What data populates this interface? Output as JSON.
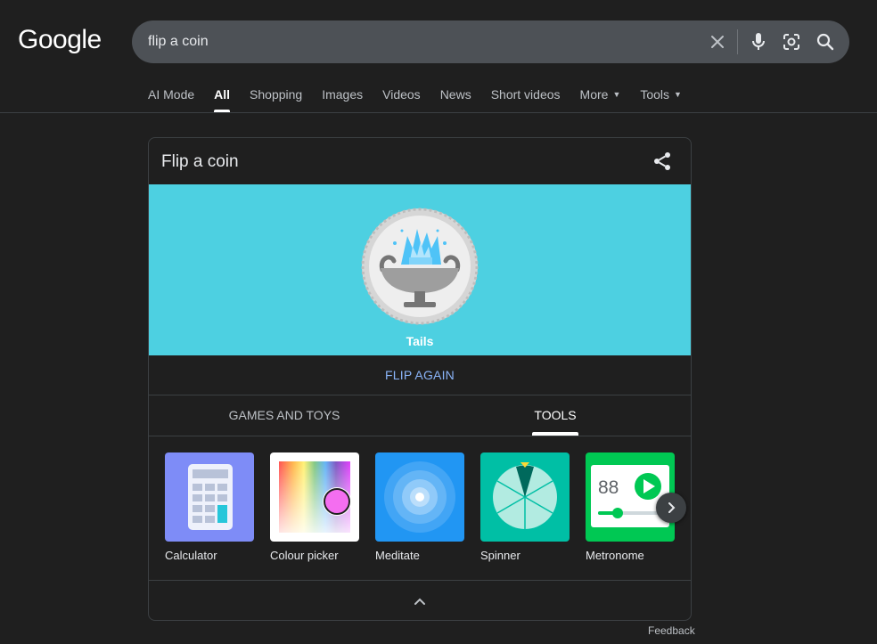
{
  "logo": "Google",
  "search": {
    "query": "flip a coin"
  },
  "tabs": [
    {
      "label": "AI Mode"
    },
    {
      "label": "All"
    },
    {
      "label": "Shopping"
    },
    {
      "label": "Images"
    },
    {
      "label": "Videos"
    },
    {
      "label": "News"
    },
    {
      "label": "Short videos"
    },
    {
      "label": "More"
    },
    {
      "label": "Tools"
    }
  ],
  "card": {
    "title": "Flip a coin",
    "result": "Tails",
    "flip_again": "FLIP AGAIN",
    "categories": [
      {
        "label": "GAMES AND TOYS"
      },
      {
        "label": "TOOLS"
      }
    ],
    "tools": [
      {
        "label": "Calculator"
      },
      {
        "label": "Colour picker"
      },
      {
        "label": "Meditate"
      },
      {
        "label": "Spinner"
      },
      {
        "label": "Metronome",
        "bpm": "88"
      }
    ]
  },
  "feedback": "Feedback",
  "colors": {
    "background": "#1f1f1f",
    "coin_area": "#4dd0e1",
    "link": "#8ab4f8",
    "search_bar": "#4d5156"
  }
}
